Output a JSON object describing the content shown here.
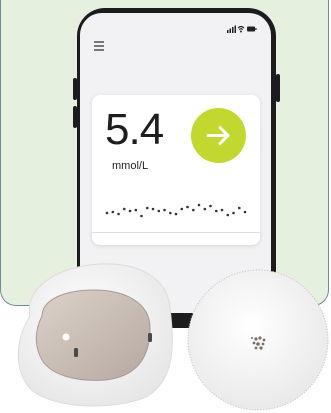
{
  "reading": {
    "value": "5.4",
    "unit": "mmol/L"
  },
  "trend": [
    0.35,
    0.4,
    0.3,
    0.55,
    0.45,
    0.5,
    0.2,
    0.6,
    0.55,
    0.45,
    0.5,
    0.35,
    0.3,
    0.55,
    0.65,
    0.5,
    0.75,
    0.55,
    0.7,
    0.45,
    0.5,
    0.25,
    0.35,
    0.6,
    0.4
  ],
  "colors": {
    "panel": "#e6f0df",
    "accent": "#c3d82e",
    "phone": "#1b1c1e"
  },
  "icons": [
    "menu-icon",
    "signal-icon",
    "wifi-icon",
    "battery-icon",
    "arrow-right-icon"
  ]
}
